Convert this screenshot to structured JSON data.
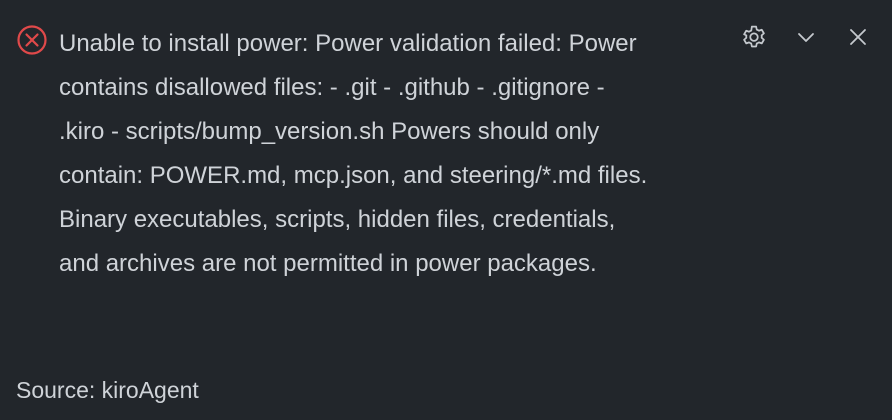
{
  "notification": {
    "severity": "error",
    "message_lines": [
      "Unable to install power: Power validation failed: Power",
      "contains disallowed files: - .git - .github - .gitignore -",
      ".kiro - scripts/bump_version.sh Powers should only",
      "contain: POWER.md, mcp.json, and steering/*.md files.",
      "Binary executables, scripts, hidden files, credentials,",
      "and archives are not permitted in power packages."
    ],
    "source": "Source: kiroAgent",
    "icons": {
      "status": "error-circle-x-icon",
      "settings": "gear-icon",
      "collapse": "chevron-down-icon",
      "close": "close-icon"
    }
  },
  "colors": {
    "background": "#22262b",
    "text": "#cfd3d8",
    "error": "#e0494a",
    "icon": "#c5c9ce"
  }
}
